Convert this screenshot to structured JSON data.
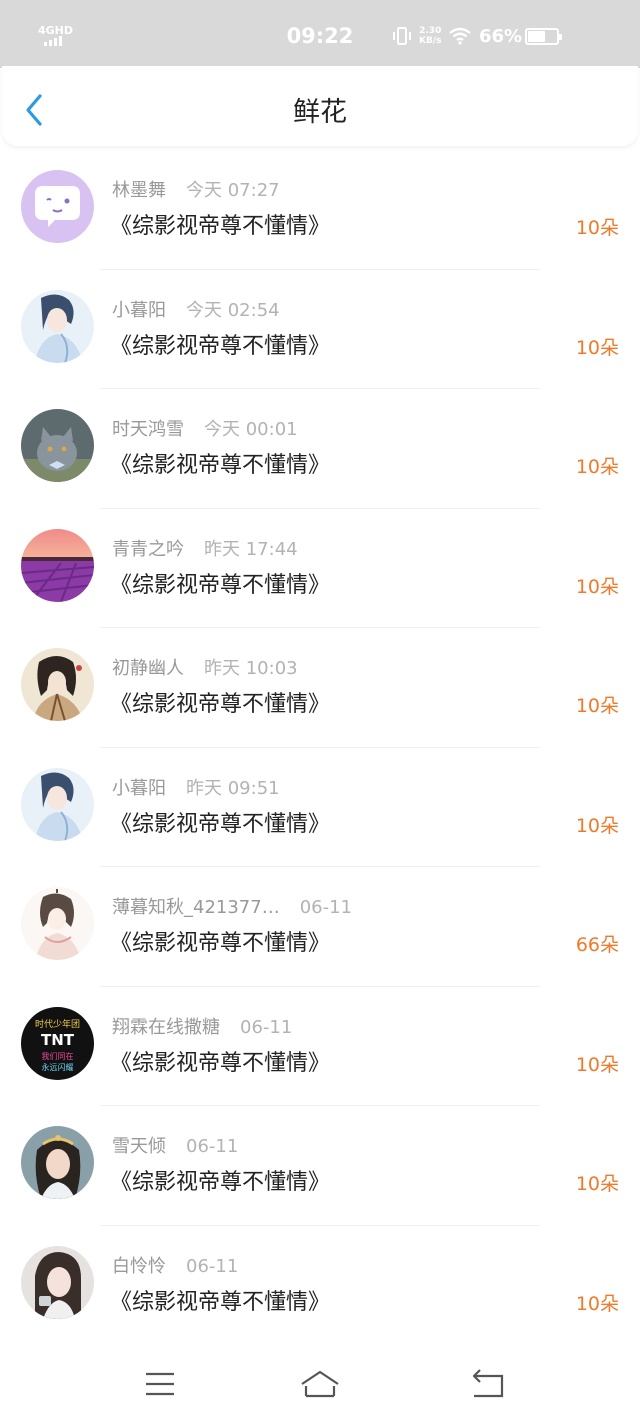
{
  "status": {
    "network": "4GHD",
    "time": "09:22",
    "speed_value": "2.30",
    "speed_unit": "KB/s",
    "battery_pct": "66%",
    "battery_level": 0.66,
    "icons": [
      "signal-icon",
      "vibrate-icon",
      "wifi-icon",
      "battery-icon"
    ]
  },
  "header": {
    "title": "鲜花",
    "back_icon": "chevron-left-icon"
  },
  "colors": {
    "accent_back": "#2b9ae3",
    "count_orange": "#f07a2a",
    "name_gray": "#999999",
    "status_bar_bg": "#d9d9d9"
  },
  "items": [
    {
      "name": "林墨舞",
      "time": "今天 07:27",
      "book": "《综影视帝尊不懂情》",
      "count": "10朵"
    },
    {
      "name": "小暮阳",
      "time": "今天 02:54",
      "book": "《综影视帝尊不懂情》",
      "count": "10朵"
    },
    {
      "name": "时天鸿雪",
      "time": "今天 00:01",
      "book": "《综影视帝尊不懂情》",
      "count": "10朵"
    },
    {
      "name": "青青之吟",
      "time": "昨天 17:44",
      "book": "《综影视帝尊不懂情》",
      "count": "10朵"
    },
    {
      "name": "初静幽人",
      "time": "昨天 10:03",
      "book": "《综影视帝尊不懂情》",
      "count": "10朵"
    },
    {
      "name": "小暮阳",
      "time": "昨天 09:51",
      "book": "《综影视帝尊不懂情》",
      "count": "10朵"
    },
    {
      "name": "薄暮知秋_421377…",
      "time": "06-11",
      "book": "《综影视帝尊不懂情》",
      "count": "66朵"
    },
    {
      "name": "翔霖在线撒糖",
      "time": "06-11",
      "book": "《综影视帝尊不懂情》",
      "count": "10朵"
    },
    {
      "name": "雪天倾",
      "time": "06-11",
      "book": "《综影视帝尊不懂情》",
      "count": "10朵"
    },
    {
      "name": "白怜怜",
      "time": "06-11",
      "book": "《综影视帝尊不懂情》",
      "count": "10朵"
    }
  ],
  "avatar_text": {
    "tnt": [
      "时代少年团",
      "TNT",
      "我们同在",
      "永远闪耀"
    ]
  },
  "nav": {
    "icons": [
      "menu-icon",
      "home-icon",
      "back-icon"
    ]
  }
}
